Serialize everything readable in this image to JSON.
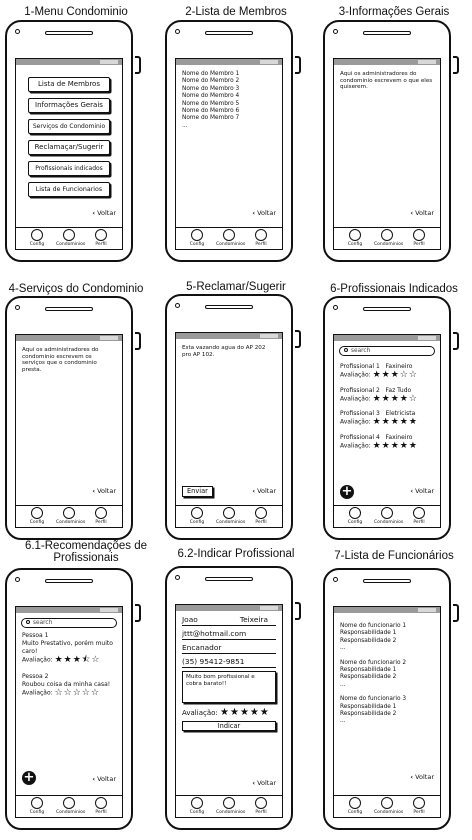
{
  "common": {
    "voltar": "Voltar",
    "back_glyph": "‹",
    "tabs": [
      "Config",
      "Condominios",
      "Perfil"
    ]
  },
  "screens": {
    "s1": {
      "title": "1-Menu Condominio",
      "buttons": [
        "Lista de Membros",
        "Informações Gerais",
        "Serviços do Condominio",
        "Reclamaçar/Sugerir",
        "Profissionais indicados",
        "Lista de Funcionarios"
      ]
    },
    "s2": {
      "title": "2-Lista de Membros",
      "members": [
        "Nome do Membro 1",
        "Nome do Membro 2",
        "Nome do Membro 3",
        "Nome do Membro 4",
        "Nome do Membro 5",
        "Nome do Membro 6",
        "Nome do Membro 7",
        "..."
      ]
    },
    "s3": {
      "title": "3-Informações Gerais",
      "text": "Aqui os administradores do condominio escrevem o que eles quiserem."
    },
    "s4": {
      "title": "4-Serviços do Condominio",
      "text": "Aqui os administradores do condominio escrevem os serviços que o condominio presta."
    },
    "s5": {
      "title": "5-Reclamar/Sugerir",
      "text": "Esta vazando agua do AP 202 pro AP 102.",
      "send": "Enviar"
    },
    "s6": {
      "title": "6-Profissionais Indicados",
      "search": "search",
      "rating_label": "Avaliação:",
      "professionals": [
        {
          "name": "Profissional 1",
          "role": "Faxineiro",
          "stars": "★★★☆☆",
          "rating": 3
        },
        {
          "name": "Profissional 2",
          "role": "Faz Tudo",
          "stars": "★★★★☆",
          "rating": 4
        },
        {
          "name": "Profissional 3",
          "role": "Eletricista",
          "stars": "★★★★★",
          "rating": 5
        },
        {
          "name": "Profissional 4",
          "role": "Faxineiro",
          "stars": "★★★★★",
          "rating": 5
        }
      ],
      "add_glyph": "+"
    },
    "s61": {
      "title": "6.1-Recomendações de Profissionais",
      "search": "search",
      "rating_label": "Avaliação:",
      "reviews": [
        {
          "person": "Pessoa 1",
          "comment": "Muito Prestativo, porém muito caro!",
          "stars": "★★★⯪☆",
          "rating": 3.5
        },
        {
          "person": "Pessoa 2",
          "comment": "Roubou coisa da minha casa!",
          "stars": "☆☆☆☆☆",
          "rating": 0
        }
      ],
      "add_glyph": "+"
    },
    "s62": {
      "title": "6.2-Indicar Profissional",
      "first_name": "Joao",
      "last_name": "Teixeira",
      "email": "jttt@hotmail.com",
      "role": "Encanador",
      "phone": "(35) 95412-9851",
      "comment": "Muito bom profissional e cobra barato!!",
      "rating_label": "Avaliação:",
      "stars": "★★★★★",
      "rating": 5,
      "submit": "Indicar"
    },
    "s7": {
      "title": "7-Lista de Funcionários",
      "employees": [
        [
          "Nome do funcionario 1",
          "Responsabilidade 1",
          "Responsabilidade 2",
          "..."
        ],
        [
          "Nome do funcionario 2",
          "Responsabilidade 1",
          "Responsabilidade 2",
          "..."
        ],
        [
          "Nome do funcionario 3",
          "Responsabilidade 1",
          "Responsabilidade 2",
          "..."
        ]
      ]
    }
  }
}
